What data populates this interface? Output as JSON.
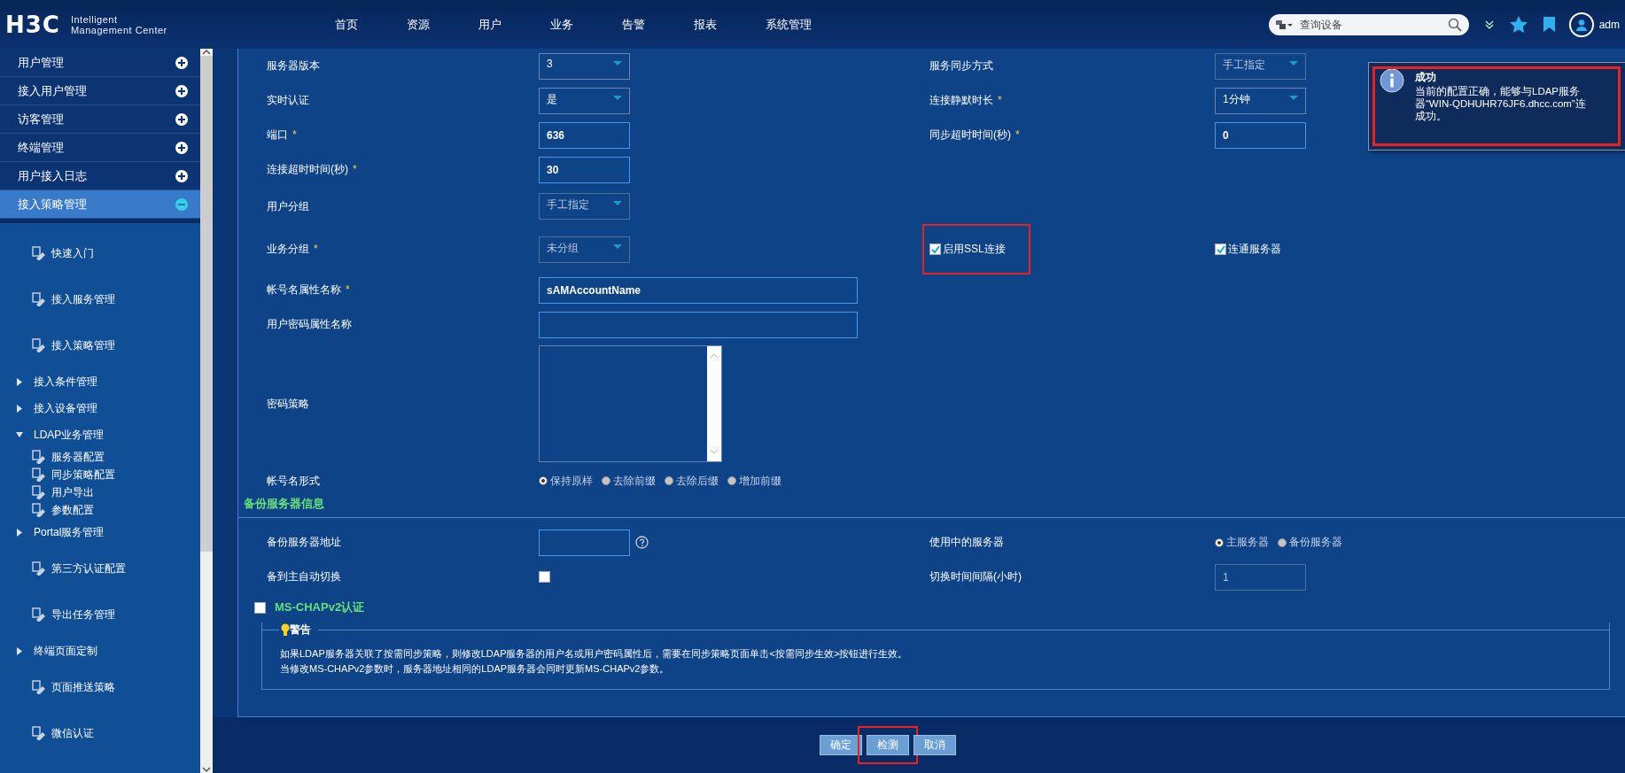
{
  "header": {
    "logo": "H3C",
    "product_lines": [
      "Intelligent",
      "Management Center"
    ],
    "nav": [
      "首页",
      "资源",
      "用户",
      "业务",
      "告警",
      "报表",
      "系统管理"
    ],
    "search": {
      "placeholder": "查询设备"
    },
    "user": "adm"
  },
  "sidebar": {
    "sections": [
      {
        "label": "用户管理",
        "selected": false
      },
      {
        "label": "接入用户管理",
        "selected": false
      },
      {
        "label": "访客管理",
        "selected": false
      },
      {
        "label": "终端管理",
        "selected": false
      },
      {
        "label": "用户接入日志",
        "selected": false
      },
      {
        "label": "接入策略管理",
        "selected": true
      }
    ],
    "items": [
      {
        "kind": "link",
        "label": "快速入门"
      },
      {
        "kind": "link",
        "label": "接入服务管理"
      },
      {
        "kind": "link",
        "label": "接入策略管理"
      },
      {
        "kind": "group",
        "label": "接入条件管理",
        "expanded": false
      },
      {
        "kind": "group",
        "label": "接入设备管理",
        "expanded": false
      },
      {
        "kind": "group",
        "label": "LDAP业务管理",
        "expanded": true,
        "children": [
          {
            "label": "服务器配置"
          },
          {
            "label": "同步策略配置"
          },
          {
            "label": "用户导出"
          },
          {
            "label": "参数配置"
          }
        ]
      },
      {
        "kind": "group",
        "label": "Portal服务管理",
        "expanded": false
      },
      {
        "kind": "link",
        "label": "第三方认证配置"
      },
      {
        "kind": "link",
        "label": "导出任务管理"
      },
      {
        "kind": "group",
        "label": "终端页面定制",
        "expanded": false
      },
      {
        "kind": "link",
        "label": "页面推送策略"
      },
      {
        "kind": "link",
        "label": "微信认证"
      }
    ]
  },
  "form": {
    "rows": [
      {
        "left": {
          "kind": "field",
          "label": "服务器版本",
          "control": {
            "kind": "select",
            "value": "3",
            "disabled": false
          }
        },
        "right": {
          "kind": "field",
          "label": "服务同步方式",
          "control": {
            "kind": "select",
            "value": "手工指定",
            "disabled": true
          }
        }
      },
      {
        "left": {
          "kind": "field",
          "label": "实时认证",
          "control": {
            "kind": "select",
            "value": "是",
            "disabled": false
          }
        },
        "right": {
          "kind": "field",
          "label": "连接静默时长",
          "required_mark": "*",
          "control": {
            "kind": "select",
            "value": "1分钟",
            "disabled": false
          }
        }
      },
      {
        "left": {
          "kind": "field",
          "label": "端口",
          "required_mark": "*",
          "control": {
            "kind": "input",
            "value": "636",
            "disabled": false
          }
        },
        "right": {
          "kind": "field",
          "label": "同步超时时间(秒)",
          "required_mark": "*",
          "control": {
            "kind": "input",
            "value": "0",
            "disabled": false
          }
        }
      },
      {
        "left": {
          "kind": "field",
          "label": "连接超时时间(秒)",
          "required_mark": "*",
          "control": {
            "kind": "input",
            "value": "30",
            "disabled": false
          }
        }
      },
      {
        "left": {
          "kind": "field",
          "label": "用户分组",
          "control": {
            "kind": "select",
            "value": "手工指定",
            "disabled": true
          }
        }
      },
      {
        "left": {
          "kind": "field",
          "label": "业务分组",
          "required_mark": "*",
          "control": {
            "kind": "select",
            "value": "未分组",
            "disabled": true
          }
        },
        "right": {
          "kind": "checkboxes",
          "items": [
            {
              "label": "启用SSL连接",
              "checked": true,
              "highlighted": true
            },
            {
              "label": "连通服务器",
              "checked": true,
              "highlighted": false
            }
          ]
        }
      },
      {
        "left": {
          "kind": "field",
          "label": "帐号名属性名称",
          "required_mark": "*",
          "control": {
            "kind": "wide-input",
            "value": "sAMAccountName"
          }
        }
      },
      {
        "left": {
          "kind": "field",
          "label": "用户密码属性名称",
          "control": {
            "kind": "wide-input"
          }
        }
      },
      {
        "left": {
          "kind": "field",
          "label": "密码策略",
          "control": {
            "kind": "textarea"
          }
        }
      },
      {
        "left": {
          "kind": "field",
          "label": "帐号名形式",
          "control": {
            "kind": "radios",
            "options": [
              {
                "label": "保持原样",
                "selected": true
              },
              {
                "label": "去除前缀",
                "selected": false
              },
              {
                "label": "去除后缀",
                "selected": false
              },
              {
                "label": "增加前缀",
                "selected": false
              }
            ]
          }
        }
      }
    ]
  },
  "backup": {
    "title": "备份服务器信息",
    "rows": [
      {
        "left": {
          "kind": "field",
          "label": "备份服务器地址",
          "control": {
            "kind": "input",
            "help": true,
            "disabled": false
          }
        },
        "right": {
          "kind": "field",
          "label": "使用中的服务器",
          "control": {
            "kind": "radios",
            "options": [
              {
                "label": "主服务器",
                "selected": true
              },
              {
                "label": "备份服务器",
                "selected": false
              }
            ]
          }
        }
      },
      {
        "left": {
          "kind": "field",
          "label": "备到主自动切换",
          "control": {
            "kind": "checkbox",
            "checked": false
          }
        },
        "right": {
          "kind": "field",
          "label": "切换时间间隔(小时)",
          "control": {
            "kind": "input",
            "value": "1",
            "disabled": true
          }
        }
      }
    ]
  },
  "mschap": {
    "label": "MS-CHAPv2认证",
    "checked": false
  },
  "warning": {
    "title": "警告",
    "lines": [
      "如果LDAP服务器关联了按需同步策略，则修改LDAP服务器的用户名或用户密码属性后，需要在同步策略页面单击<按需同步生效>按钮进行生效。",
      "当修改MS-CHAPv2参数时，服务器地址相同的LDAP服务器会同时更新MS-CHAPv2参数。"
    ]
  },
  "buttons": [
    {
      "label": "确定",
      "highlighted": false
    },
    {
      "label": "检测",
      "highlighted": true
    },
    {
      "label": "取消",
      "highlighted": false
    }
  ],
  "toast": {
    "title": "成功",
    "lines": [
      "当前的配置正确，能够与LDAP服务",
      "器“WIN-QDHUHR76JF6.dhcc.com”连",
      "成功。"
    ],
    "highlighted": true
  }
}
